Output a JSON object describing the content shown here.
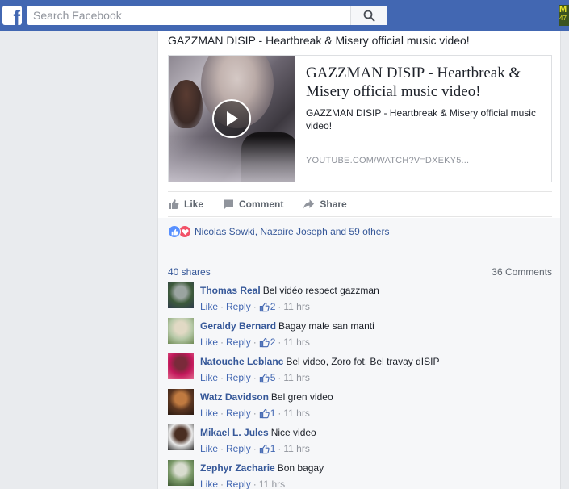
{
  "topbar": {
    "logo_letter": "f",
    "search_placeholder": "Search Facebook",
    "corner_badge_top": "M",
    "corner_badge_bottom": "47",
    "brand_color": "#4267b2"
  },
  "post": {
    "text": "GAZZMAN DISIP - Heartbreak & Misery official music video!",
    "link": {
      "title": "GAZZMAN DISIP - Heartbreak & Misery official music video!",
      "description": "GAZZMAN DISIP - Heartbreak & Misery official music video!",
      "domain": "YOUTUBE.COM/WATCH?V=DXEKY5..."
    },
    "actions": {
      "like": "Like",
      "comment": "Comment",
      "share": "Share"
    },
    "reactions_text": "Nicolas Sowki, Nazaire Joseph and 59 others",
    "shares": "40 shares",
    "comments_count": "36 Comments"
  },
  "comments": [
    {
      "author": "Thomas Real",
      "text": "Bel vidéo respect gazzman",
      "like": "Like",
      "reply": "Reply",
      "likes": "2",
      "time": "11 hrs",
      "avatar_colors": [
        "#3d5a3a",
        "#9aa4a0",
        "#2f3b4c"
      ]
    },
    {
      "author": "Geraldy Bernard",
      "text": "Bagay male san manti",
      "like": "Like",
      "reply": "Reply",
      "likes": "2",
      "time": "11 hrs",
      "avatar_colors": [
        "#b7c9a8",
        "#e1d9c4",
        "#6f8a55"
      ]
    },
    {
      "author": "Natouche Leblanc",
      "text": "Bel video, Zoro fot, Bel travay dISIP",
      "like": "Like",
      "reply": "Reply",
      "likes": "5",
      "time": "11 hrs",
      "avatar_colors": [
        "#c2185b",
        "#7a2a3a",
        "#e36a8f"
      ]
    },
    {
      "author": "Watz Davidson",
      "text": "Bel gren video",
      "like": "Like",
      "reply": "Reply",
      "likes": "1",
      "time": "11 hrs",
      "avatar_colors": [
        "#5a3520",
        "#c07a40",
        "#2a1a12"
      ]
    },
    {
      "author": "Mikael L. Jules",
      "text": "Nice video",
      "like": "Like",
      "reply": "Reply",
      "likes": "1",
      "time": "11 hrs",
      "avatar_colors": [
        "#e9e9e9",
        "#4a2e22",
        "#2e2e2e"
      ]
    },
    {
      "author": "Zephyr Zacharie",
      "text": "Bon bagay",
      "like": "Like",
      "reply": "Reply",
      "likes": "",
      "time": "11 hrs",
      "avatar_colors": [
        "#7c9a6a",
        "#d8dccf",
        "#3e5a33"
      ]
    }
  ]
}
